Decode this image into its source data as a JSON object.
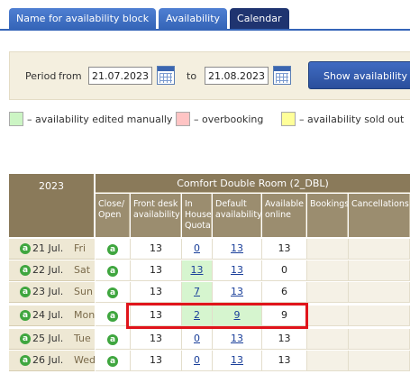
{
  "tabs": [
    {
      "label": "Name for availability block"
    },
    {
      "label": "Availability"
    },
    {
      "label": "Calendar"
    }
  ],
  "period": {
    "label_period": "Period",
    "label_from": "from",
    "from_value": "21.07.2023",
    "label_to": "to",
    "to_value": "21.08.2023",
    "show_button": "Show availability"
  },
  "legend": [
    {
      "color": "#ccf5c4",
      "text": "– availability edited manually"
    },
    {
      "color": "#ffc4c4",
      "text": "– overbooking"
    },
    {
      "color": "#ffff99",
      "text": "– availability sold out"
    }
  ],
  "table": {
    "year": "2023",
    "room_title": "Comfort Double Room (2_DBL)",
    "columns": [
      "Close/ Open",
      "Front desk availability",
      "In House Quota",
      "Default availability",
      "Available online",
      "Bookings",
      "Cancellations"
    ],
    "status_icon": "a",
    "rows": [
      {
        "date": "21 Jul.",
        "weekday": "Fri",
        "front_desk": "13",
        "in_house": "0",
        "default": "13",
        "online": "13",
        "in_house_green": false,
        "default_green": false
      },
      {
        "date": "22 Jul.",
        "weekday": "Sat",
        "front_desk": "13",
        "in_house": "13",
        "default": "13",
        "online": "0",
        "in_house_green": true,
        "default_green": false
      },
      {
        "date": "23 Jul.",
        "weekday": "Sun",
        "front_desk": "13",
        "in_house": "7",
        "default": "13",
        "online": "6",
        "in_house_green": true,
        "default_green": false
      },
      {
        "date": "24 Jul.",
        "weekday": "Mon",
        "front_desk": "13",
        "in_house": "2",
        "default": "9",
        "online": "9",
        "in_house_green": true,
        "default_green": true
      },
      {
        "date": "25 Jul.",
        "weekday": "Tue",
        "front_desk": "13",
        "in_house": "0",
        "default": "13",
        "online": "13",
        "in_house_green": false,
        "default_green": false
      },
      {
        "date": "26 Jul.",
        "weekday": "Wed",
        "front_desk": "13",
        "in_house": "0",
        "default": "13",
        "online": "13",
        "in_house_green": false,
        "default_green": false
      }
    ]
  }
}
